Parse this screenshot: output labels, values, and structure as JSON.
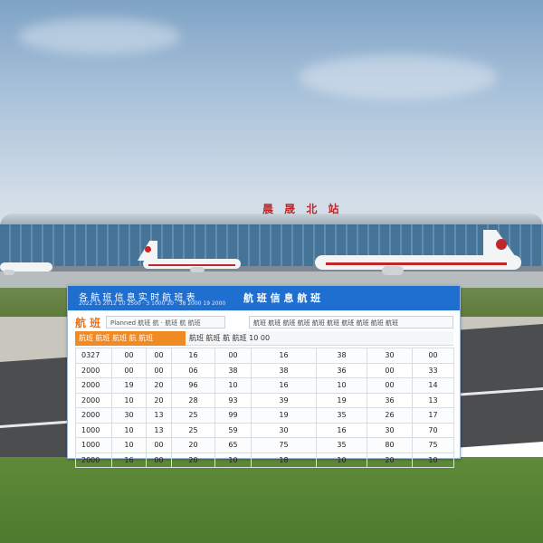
{
  "terminal_sign": "晨 晟 北 站",
  "panel": {
    "title_left": "各 航 班 信 息 实 时 航 班 表",
    "subtitle_left": "2022 13 2012 10 2500 · 3 1000 20 ·  38 2000 19 2000",
    "title_right": "航 班 信 息 航 班"
  },
  "toolbar": {
    "heading": "航 班",
    "field_text": "Planned  航班 航 · 航班 航  航班",
    "info_text": "航班 航班 航班 航班 航班 航班 航班 航班 航班 航班"
  },
  "tabs": {
    "active": "航班    航班 航班 航 航班",
    "inactive": "航班 航班    航 航班 10 00"
  },
  "table": {
    "rows": [
      [
        "0327",
        "00",
        "00",
        "16",
        "00",
        "16",
        "38",
        "30",
        "00"
      ],
      [
        "2000",
        "00",
        "00",
        "06",
        "38",
        "38",
        "36",
        "00",
        "33"
      ],
      [
        "2000",
        "19",
        "20",
        "96",
        "10",
        "16",
        "10",
        "00",
        "14"
      ],
      [
        "2000",
        "10",
        "20",
        "28",
        "93",
        "39",
        "19",
        "36",
        "13"
      ],
      [
        "2000",
        "30",
        "13",
        "25",
        "99",
        "19",
        "35",
        "26",
        "17"
      ],
      [
        "1000",
        "10",
        "13",
        "25",
        "59",
        "30",
        "16",
        "30",
        "70"
      ],
      [
        "1000",
        "10",
        "00",
        "20",
        "65",
        "75",
        "35",
        "80",
        "75"
      ],
      [
        "2000",
        "16",
        "00",
        "20",
        "10",
        "18",
        "10",
        "20",
        "10"
      ]
    ]
  },
  "colors": {
    "header_blue": "#1f6fd0",
    "accent_orange": "#f08a24",
    "brand_red": "#c0262b"
  }
}
